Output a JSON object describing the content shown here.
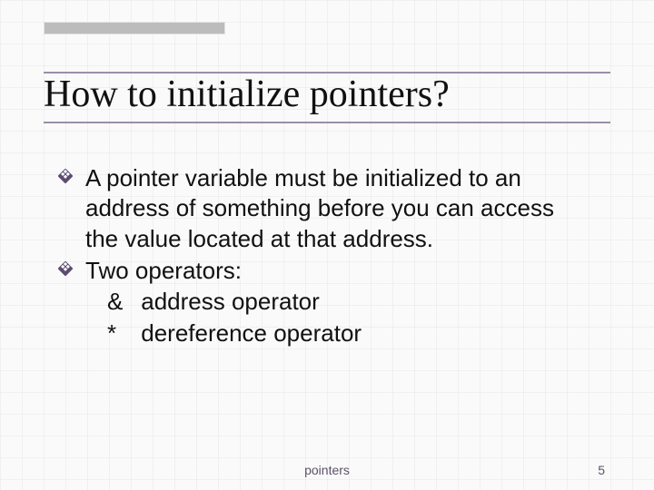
{
  "slide": {
    "title": "How to initialize pointers?",
    "bullets": [
      {
        "text": "A pointer variable must be initialized to an address of something before you can access the value located at that address."
      },
      {
        "text": "Two operators:",
        "sublines": [
          {
            "symbol": "&",
            "label": "address operator"
          },
          {
            "symbol": "*",
            "label": "dereference operator"
          }
        ]
      }
    ],
    "footer": {
      "center": "pointers",
      "page": "5"
    }
  }
}
